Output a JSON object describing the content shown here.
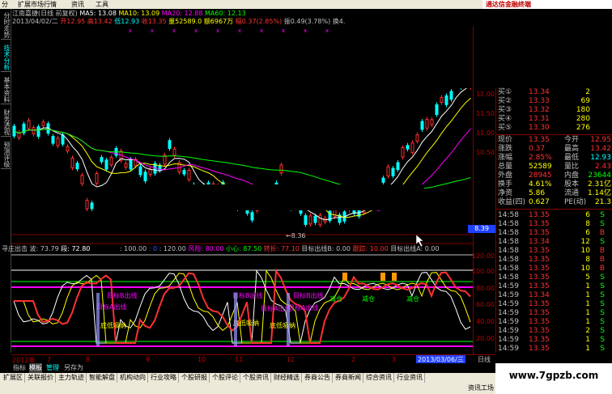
{
  "menu": {
    "items": [
      "分",
      "扩展市场行情",
      "资讯",
      "工具"
    ],
    "brand": "通达信金融终端"
  },
  "sidetabs": [
    "分时走势",
    "技术分析",
    "基本资料",
    "财务透视",
    "预测评级"
  ],
  "info1": {
    "stock": "江南嘉捷(日线 前复权)",
    "ma5": "MA5: 13.08",
    "ma10": "MA10: 13.09",
    "ma20": "MA20: 12.88",
    "ma60": "MA60: 12.13"
  },
  "info2": {
    "date": "2013/04/02/二",
    "open": "开12.95",
    "high": "高13.42",
    "low": "低12.93",
    "close": "收13.35",
    "vol": "量52589.0",
    "amt": "额6967万",
    "chg": "幅0.37(2.85%)",
    "swing": "振0.49(3.78%)",
    "turnover": "换4.61%",
    "fu": "复"
  },
  "annotations": {
    "low_mark": "8.36"
  },
  "price_axis": {
    "ticks": [
      "12.00",
      "11.50",
      "11.00",
      "10.50"
    ],
    "current": "8.39",
    "ind_ticks": [
      "120.00",
      "100.00",
      "80.00",
      "60.00",
      "40.00",
      "20.00"
    ]
  },
  "indicator": {
    "name": "寻庄出击",
    "bo": "波: 73.79",
    "jue": "段: 72.80",
    "v100": ": 100.00",
    "v0": ": 0",
    "v120": ": 120.00",
    "risk": "风险: 80.00",
    "care": "小心: 87.50",
    "zhuan": "转折: 77.10",
    "ptB": "目标出线B: 0.00",
    "gz": "跟踪: 10.00",
    "ptA": "目标出线A: 0.00"
  },
  "signals": {
    "target_a": "目标A出线",
    "target_b": "目标B出线",
    "low_absorb": "底低吸纳",
    "reduce": "减仓"
  },
  "quote": {
    "buy": [
      {
        "label": "买①",
        "price": "13.34",
        "vol": "2"
      },
      {
        "label": "买②",
        "price": "13.33",
        "vol": "69"
      },
      {
        "label": "买③",
        "price": "13.32",
        "vol": "180"
      },
      {
        "label": "买④",
        "price": "13.31",
        "vol": "280"
      },
      {
        "label": "买⑤",
        "price": "13.30",
        "vol": "276"
      }
    ],
    "stats": [
      {
        "l1": "现价",
        "v1": "13.35",
        "l2": "今开",
        "v2": "12.95"
      },
      {
        "l1": "涨跌",
        "v1": "0.37",
        "l2": "最高",
        "v2": "13.42"
      },
      {
        "l1": "涨幅",
        "v1": "2.85%",
        "l2": "最低",
        "v2": "12.93"
      },
      {
        "l1": "总量",
        "v1": "52589",
        "l2": "量比",
        "v2": "2.43"
      },
      {
        "l1": "外盘",
        "v1": "28945",
        "l2": "内盘",
        "v2": "23644"
      },
      {
        "l1": "换手",
        "v1": "4.61%",
        "l2": "股本",
        "v2": "2.31亿"
      },
      {
        "l1": "净资",
        "v1": "5.86",
        "l2": "流通",
        "v2": "1.14亿"
      },
      {
        "l1": "收益(四)",
        "v1": "0.627",
        "l2": "PE(动)",
        "v2": "21.3"
      }
    ],
    "ticks": [
      {
        "time": "14:58",
        "price": "13.35",
        "vol": "6",
        "dir": "S"
      },
      {
        "time": "14:58",
        "price": "13.35",
        "vol": "8",
        "dir": "S"
      },
      {
        "time": "14:58",
        "price": "13.35",
        "vol": "6",
        "dir": "B"
      },
      {
        "time": "14:58",
        "price": "13.34",
        "vol": "12",
        "dir": "S"
      },
      {
        "time": "14:58",
        "price": "13.35",
        "vol": "10",
        "dir": "B"
      },
      {
        "time": "14:58",
        "price": "13.35",
        "vol": "8",
        "dir": "B"
      },
      {
        "time": "14:58",
        "price": "13.35",
        "vol": "10",
        "dir": "B"
      },
      {
        "time": "14:58",
        "price": "13.35",
        "vol": "5",
        "dir": "S"
      },
      {
        "time": "14:59",
        "price": "13.35",
        "vol": "1",
        "dir": "S"
      },
      {
        "time": "14:59",
        "price": "13.34",
        "vol": "1",
        "dir": "S"
      },
      {
        "time": "14:59",
        "price": "13.35",
        "vol": "1",
        "dir": "S"
      },
      {
        "time": "14:59",
        "price": "13.35",
        "vol": "1",
        "dir": "S"
      },
      {
        "time": "14:59",
        "price": "13.35",
        "vol": "1",
        "dir": "S"
      },
      {
        "time": "14:59",
        "price": "13.35",
        "vol": "2",
        "dir": "S"
      },
      {
        "time": "14:59",
        "price": "13.35",
        "vol": "1",
        "dir": "S"
      },
      {
        "time": "14:59",
        "price": "13.35",
        "vol": "1",
        "dir": "S"
      },
      {
        "time": "14:59",
        "price": "13.35",
        "vol": "4",
        "dir": "S"
      }
    ]
  },
  "dates": [
    "2012年",
    "7",
    "8",
    "9",
    "10",
    "11",
    "12",
    "2",
    "3"
  ],
  "date_current": "2013/03/06/三",
  "formula_tabs": [
    "指标",
    "模板",
    "管理",
    "另存为"
  ],
  "period_tab": "日线",
  "taskbar": [
    "扩展区",
    "关联报价",
    "主力轨迹",
    "智能解盘",
    "机构动向",
    "行业攻略",
    "个股研报",
    "个股评论",
    "个股资讯",
    "财经精选",
    "券商公告",
    "券商新闻",
    "综合资讯",
    "行业资讯"
  ],
  "status": "资讯工场",
  "watermark": "www.7gpzb.com",
  "colors": {
    "up": "#ff3030",
    "down": "#00ffff",
    "ma5": "#ffffff",
    "ma10": "#ffff00",
    "ma20": "#ff00ff",
    "ma60": "#00ff00",
    "axis": "#800000"
  }
}
